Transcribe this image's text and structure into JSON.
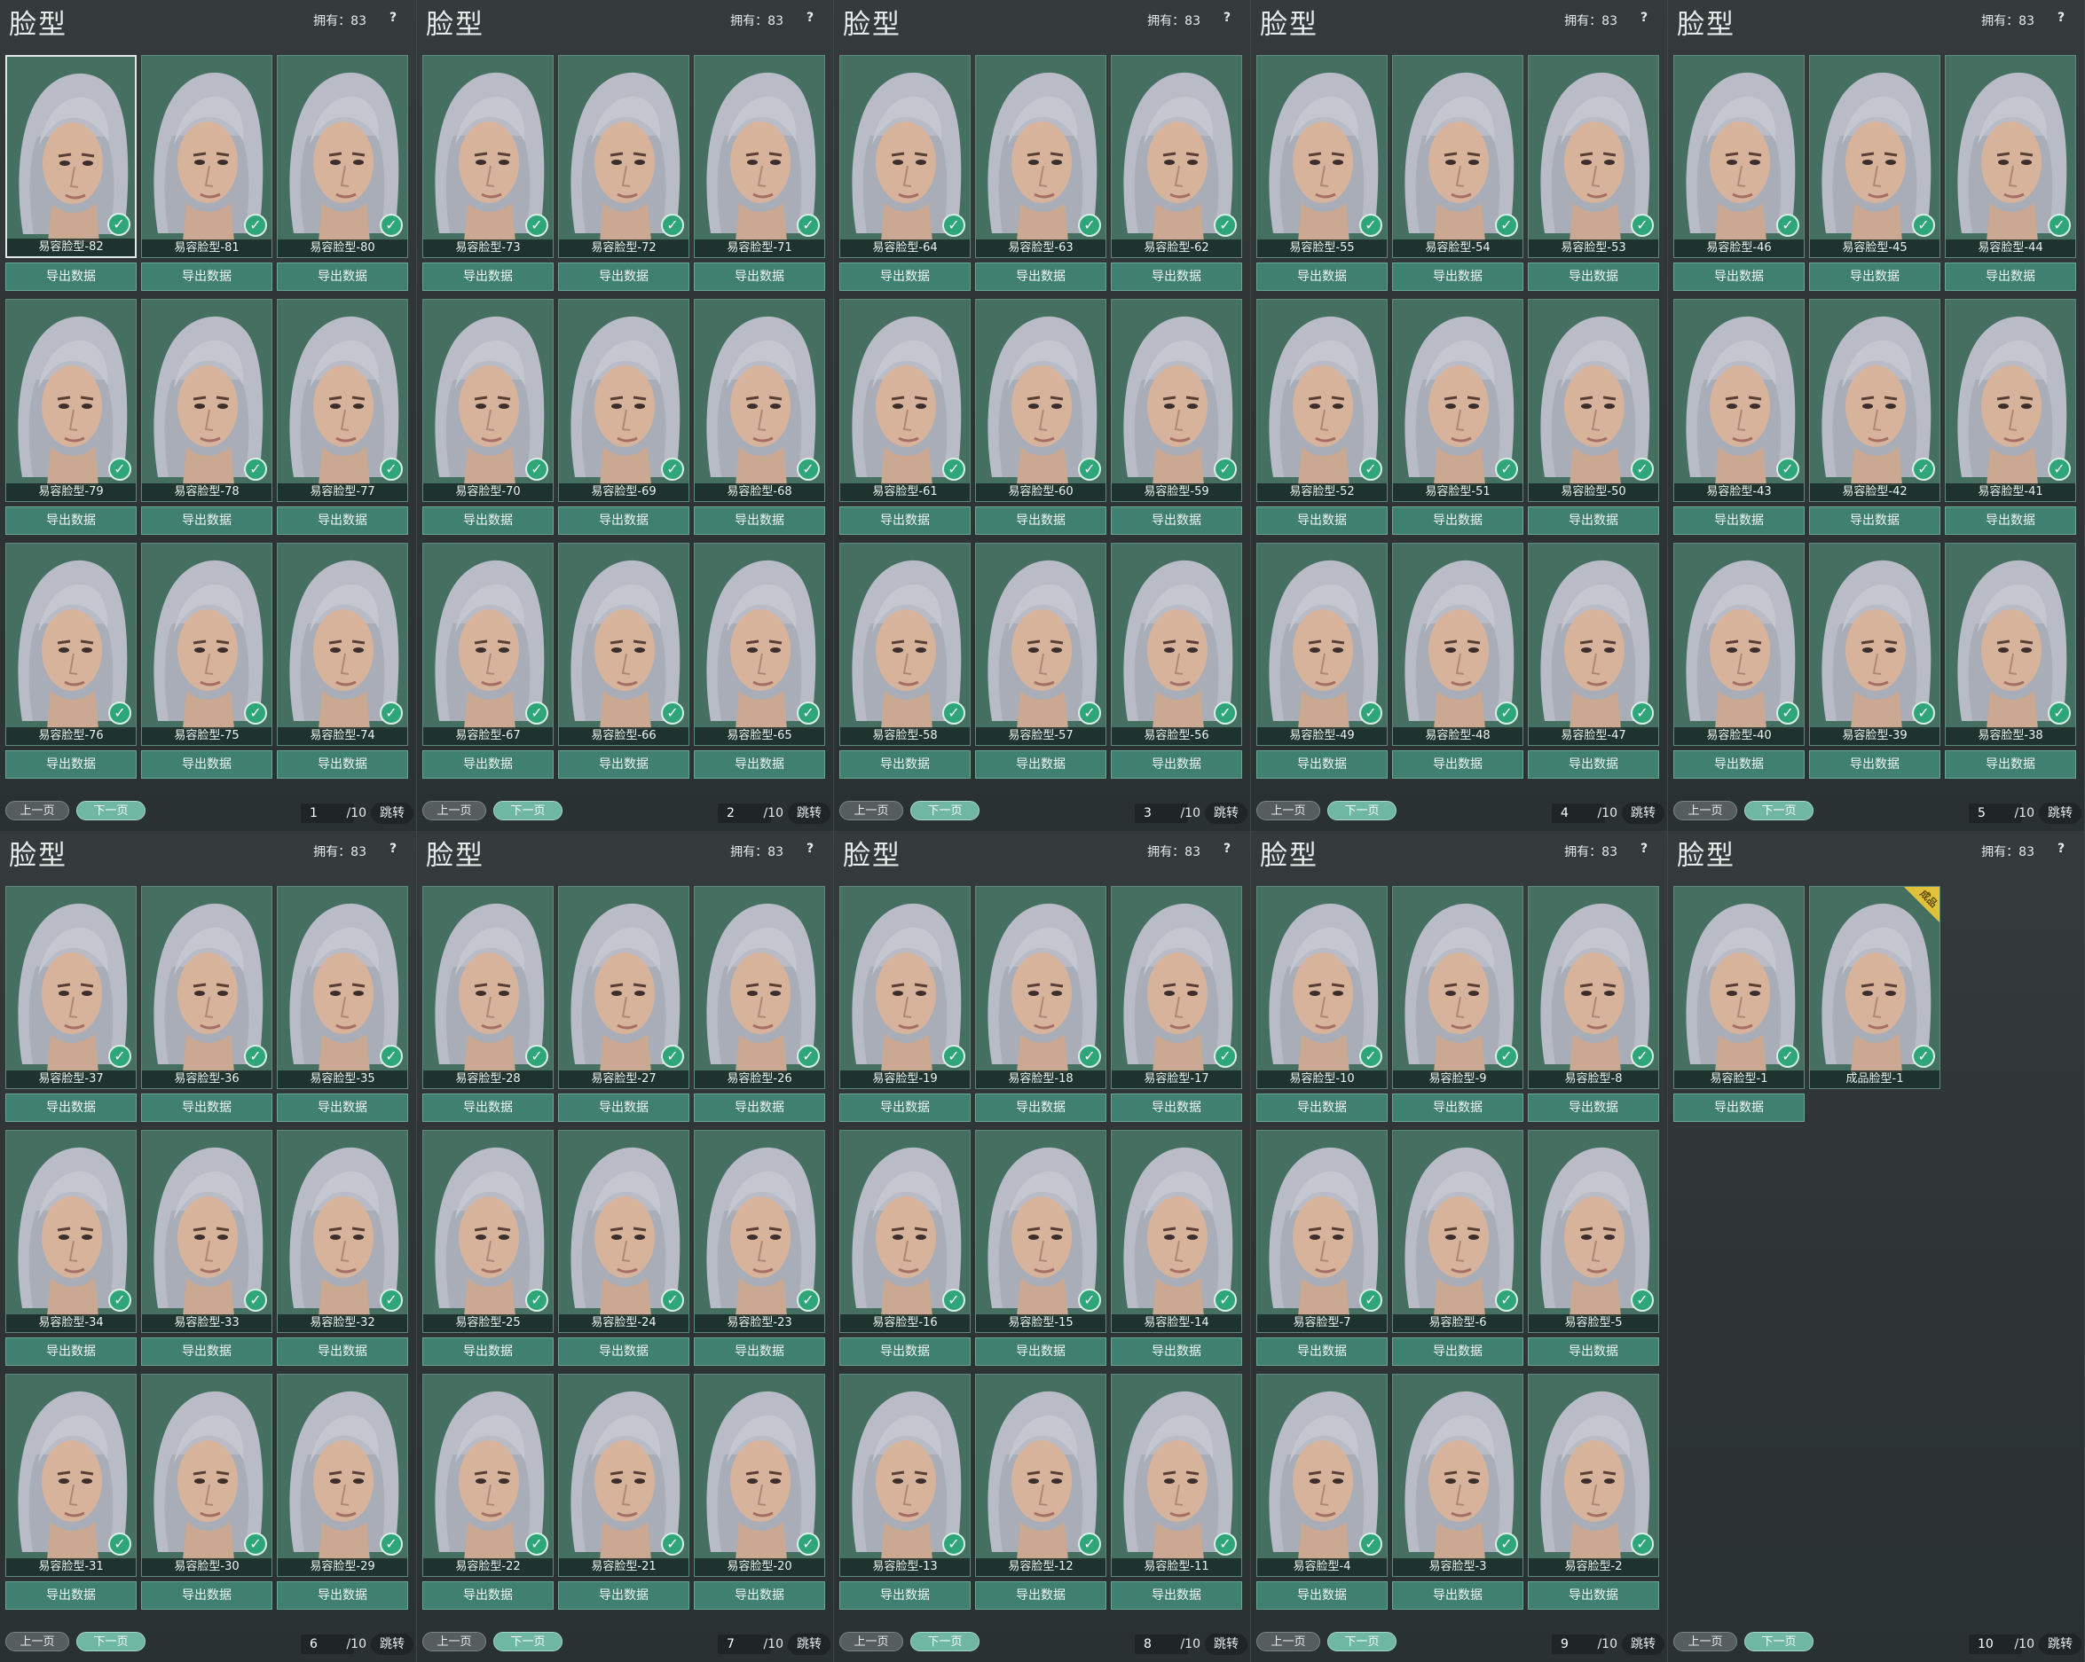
{
  "panel_title": "脸型",
  "owned_label": "拥有：83",
  "help_label": "?",
  "export_label": "导出数据",
  "prev_label": "上一页",
  "next_label": "下一页",
  "jump_label": "跳转",
  "total_pages_label": "/10",
  "check_glyph": "✓",
  "pages": [
    {
      "page": "1",
      "faces": [
        "易容脸型-82",
        "易容脸型-81",
        "易容脸型-80",
        "易容脸型-79",
        "易容脸型-78",
        "易容脸型-77",
        "易容脸型-76",
        "易容脸型-75",
        "易容脸型-74"
      ]
    },
    {
      "page": "2",
      "faces": [
        "易容脸型-73",
        "易容脸型-72",
        "易容脸型-71",
        "易容脸型-70",
        "易容脸型-69",
        "易容脸型-68",
        "易容脸型-67",
        "易容脸型-66",
        "易容脸型-65"
      ]
    },
    {
      "page": "3",
      "faces": [
        "易容脸型-64",
        "易容脸型-63",
        "易容脸型-62",
        "易容脸型-61",
        "易容脸型-60",
        "易容脸型-59",
        "易容脸型-58",
        "易容脸型-57",
        "易容脸型-56"
      ]
    },
    {
      "page": "4",
      "faces": [
        "易容脸型-55",
        "易容脸型-54",
        "易容脸型-53",
        "易容脸型-52",
        "易容脸型-51",
        "易容脸型-50",
        "易容脸型-49",
        "易容脸型-48",
        "易容脸型-47"
      ]
    },
    {
      "page": "5",
      "faces": [
        "易容脸型-46",
        "易容脸型-45",
        "易容脸型-44",
        "易容脸型-43",
        "易容脸型-42",
        "易容脸型-41",
        "易容脸型-40",
        "易容脸型-39",
        "易容脸型-38"
      ]
    },
    {
      "page": "6",
      "faces": [
        "易容脸型-37",
        "易容脸型-36",
        "易容脸型-35",
        "易容脸型-34",
        "易容脸型-33",
        "易容脸型-32",
        "易容脸型-31",
        "易容脸型-30",
        "易容脸型-29"
      ]
    },
    {
      "page": "7",
      "faces": [
        "易容脸型-28",
        "易容脸型-27",
        "易容脸型-26",
        "易容脸型-25",
        "易容脸型-24",
        "易容脸型-23",
        "易容脸型-22",
        "易容脸型-21",
        "易容脸型-20"
      ]
    },
    {
      "page": "8",
      "faces": [
        "易容脸型-19",
        "易容脸型-18",
        "易容脸型-17",
        "易容脸型-16",
        "易容脸型-15",
        "易容脸型-14",
        "易容脸型-13",
        "易容脸型-12",
        "易容脸型-11"
      ]
    },
    {
      "page": "9",
      "faces": [
        "易容脸型-10",
        "易容脸型-9",
        "易容脸型-8",
        "易容脸型-7",
        "易容脸型-6",
        "易容脸型-5",
        "易容脸型-4",
        "易容脸型-3",
        "易容脸型-2"
      ]
    },
    {
      "page": "10",
      "faces": [
        "易容脸型-1",
        "成品脸型-1"
      ],
      "badge_label": "成品"
    }
  ],
  "colors": {
    "card": "#3f6a5c",
    "export_button": "#3f8070",
    "next_button": "#6fb7a3",
    "check": "#2fa57a",
    "badge": "#e2c23a"
  }
}
